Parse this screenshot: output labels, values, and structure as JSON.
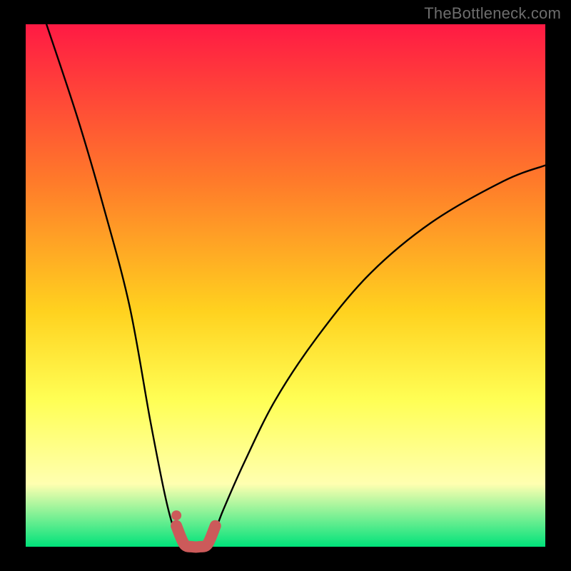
{
  "watermark": "TheBottleneck.com",
  "colors": {
    "frame_bg": "#000000",
    "gradient_top": "#ff1a44",
    "gradient_mid1": "#ff7a2a",
    "gradient_mid2": "#ffd21f",
    "gradient_mid3": "#ffff55",
    "gradient_mid4": "#ffffb0",
    "gradient_bottom": "#00e27a",
    "curve": "#000000",
    "marker_stroke": "#cc5a5a",
    "marker_fill": "#cc5a5a"
  },
  "chart_data": {
    "type": "line",
    "title": "",
    "xlabel": "",
    "ylabel": "",
    "xlim": [
      0,
      100
    ],
    "ylim": [
      0,
      100
    ],
    "series": [
      {
        "name": "bottleneck-curve",
        "x": [
          4,
          10,
          15,
          20,
          24,
          27,
          29,
          30.5,
          32,
          34,
          36,
          38,
          42,
          48,
          56,
          66,
          78,
          92,
          100
        ],
        "y": [
          100,
          82,
          65,
          46,
          24,
          9,
          2,
          0,
          0,
          0,
          2,
          7,
          16,
          28,
          40,
          52,
          62,
          70,
          73
        ]
      }
    ],
    "highlight": {
      "name": "marker-band",
      "x": [
        29,
        30.5,
        32,
        33.5,
        35,
        36.5
      ],
      "y": [
        4,
        0.5,
        0,
        0,
        0.5,
        4
      ],
      "dot": {
        "x": 29,
        "y": 6
      }
    },
    "notes": "No axes, ticks, or legend are visible. Values are estimates read from the normalized plot area expressed as percentages of width/height from the lower-left origin."
  }
}
